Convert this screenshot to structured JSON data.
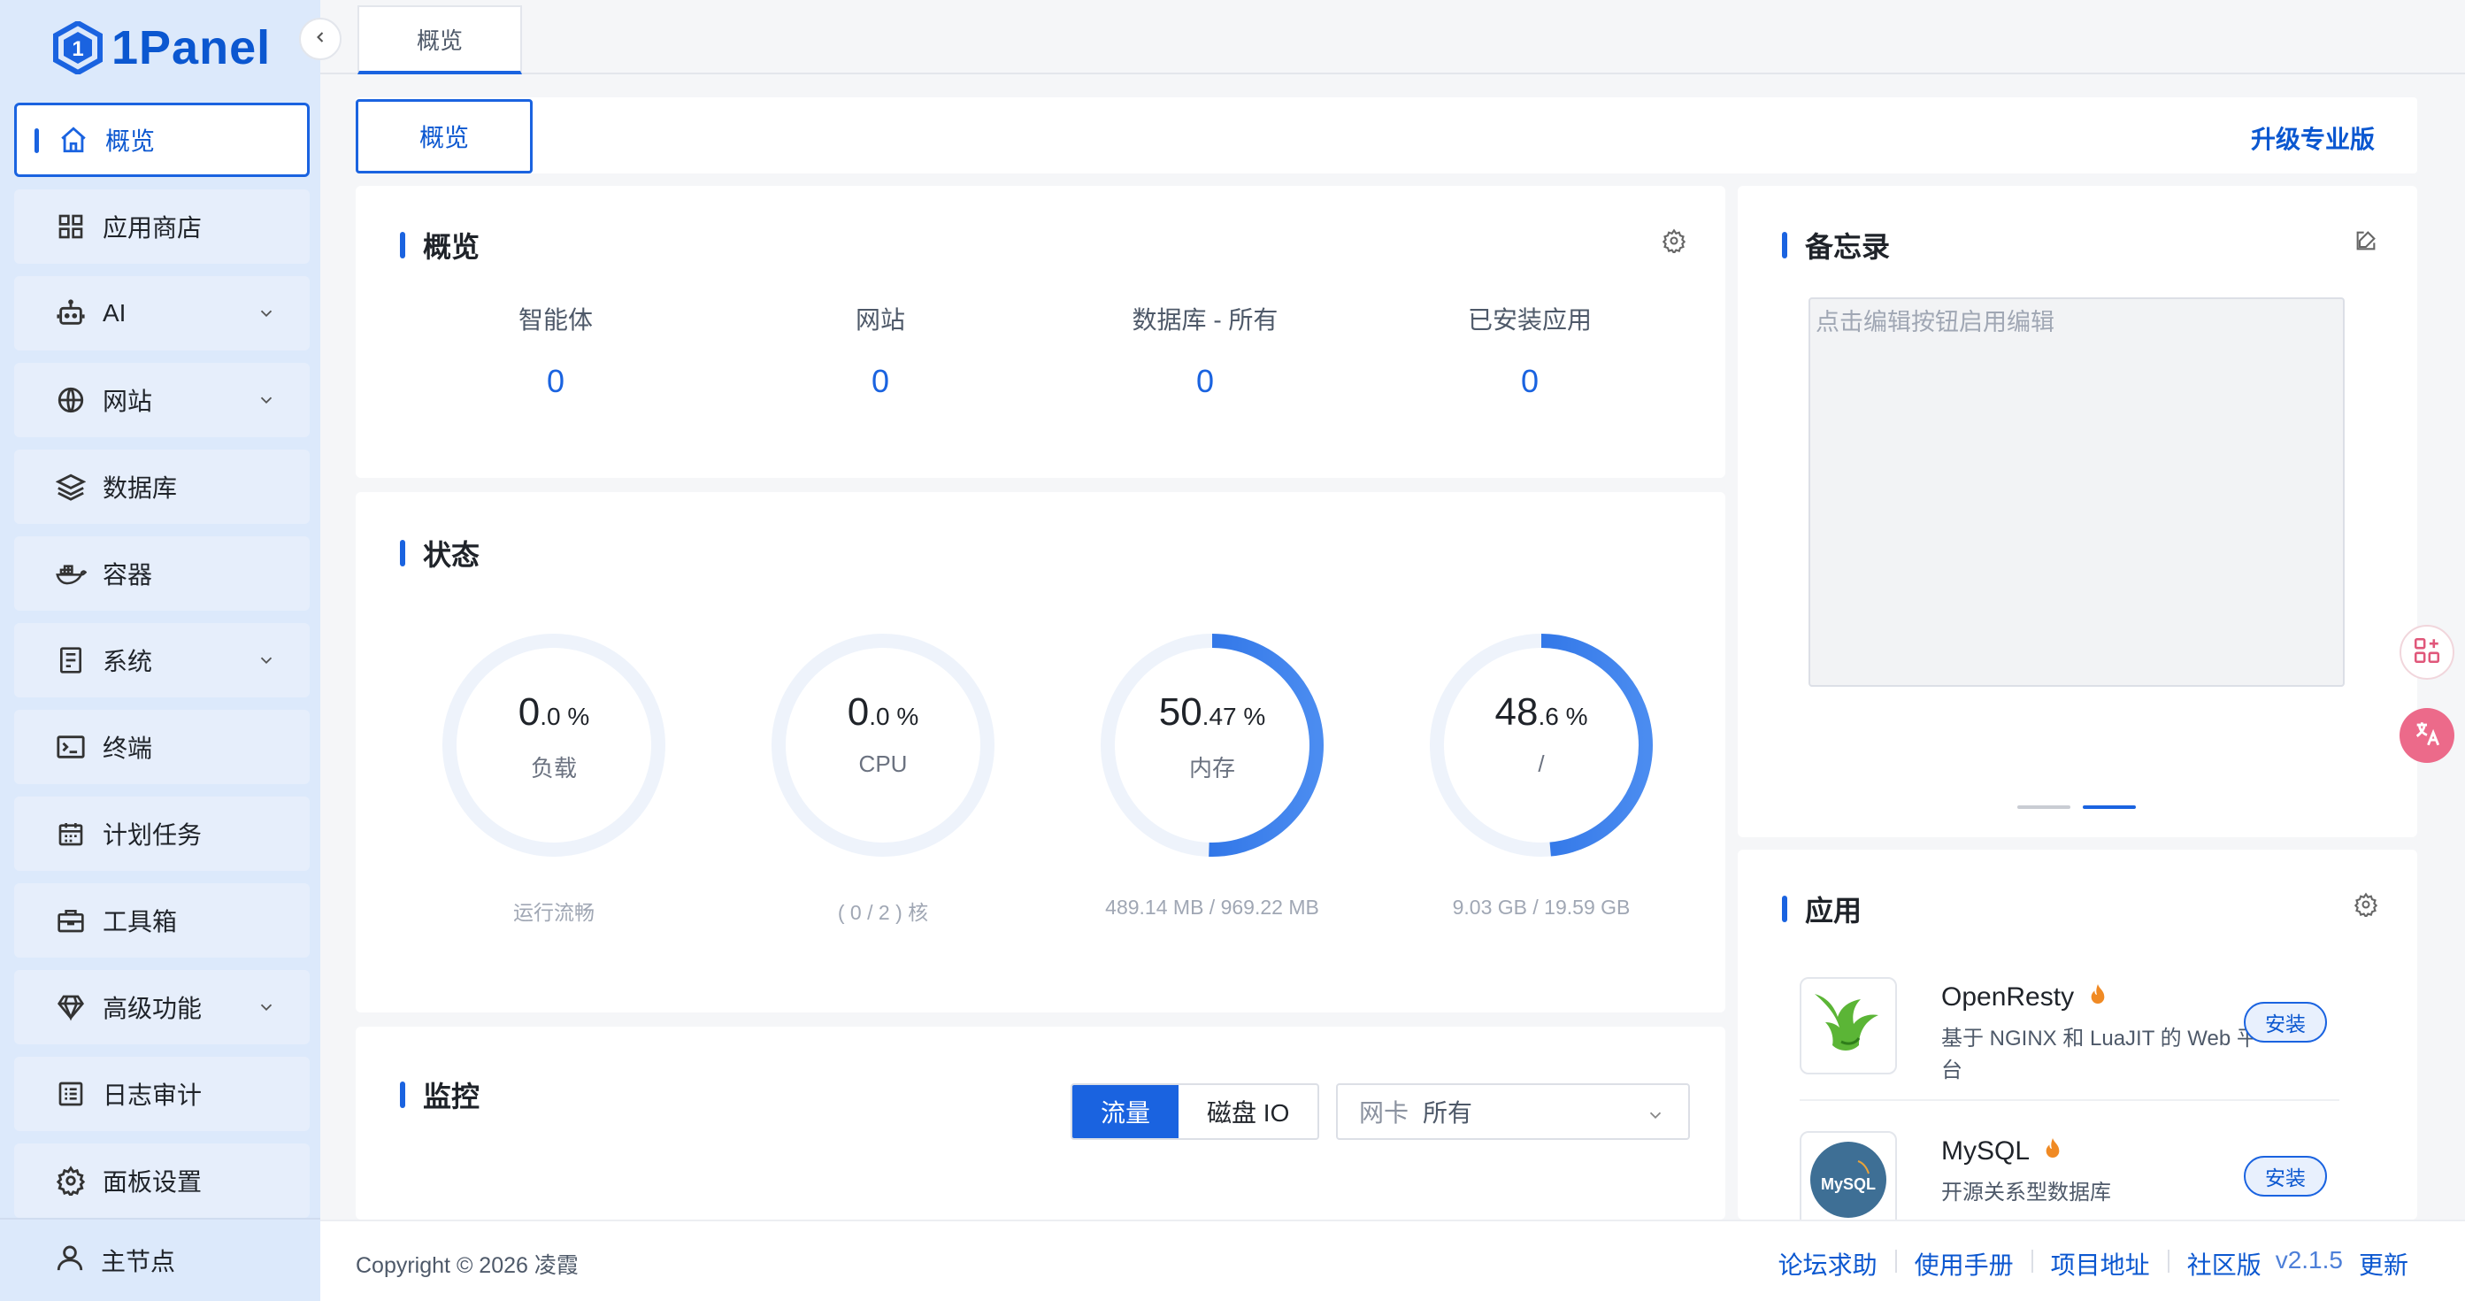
{
  "app": {
    "logo_text": "1Panel"
  },
  "sidebar": {
    "items": [
      {
        "label": "概览",
        "icon": "home-icon",
        "active": true
      },
      {
        "label": "应用商店",
        "icon": "grid-icon"
      },
      {
        "label": "AI",
        "icon": "robot-icon",
        "expandable": true
      },
      {
        "label": "网站",
        "icon": "globe-icon",
        "expandable": true
      },
      {
        "label": "数据库",
        "icon": "layers-icon"
      },
      {
        "label": "容器",
        "icon": "docker-icon"
      },
      {
        "label": "系统",
        "icon": "server-icon",
        "expandable": true
      },
      {
        "label": "终端",
        "icon": "terminal-icon"
      },
      {
        "label": "计划任务",
        "icon": "calendar-icon"
      },
      {
        "label": "工具箱",
        "icon": "toolbox-icon"
      },
      {
        "label": "高级功能",
        "icon": "diamond-icon",
        "expandable": true
      },
      {
        "label": "日志审计",
        "icon": "log-icon"
      },
      {
        "label": "面板设置",
        "icon": "settings-icon"
      }
    ],
    "bottom": {
      "label": "主节点",
      "icon": "user-icon"
    }
  },
  "tabs": [
    {
      "label": "概览"
    }
  ],
  "header": {
    "tab_label": "概览",
    "upgrade_label": "升级专业版"
  },
  "overview": {
    "title": "概览",
    "stats": [
      {
        "label": "智能体",
        "value": "0"
      },
      {
        "label": "网站",
        "value": "0"
      },
      {
        "label": "数据库 - 所有",
        "value": "0"
      },
      {
        "label": "已安装应用",
        "value": "0"
      }
    ]
  },
  "status": {
    "title": "状态",
    "gauges": [
      {
        "int": "0",
        "dec": ".0 %",
        "label": "负载",
        "sub": "运行流畅",
        "percent": 0
      },
      {
        "int": "0",
        "dec": ".0 %",
        "label": "CPU",
        "sub": "( 0 / 2 ) 核",
        "percent": 0
      },
      {
        "int": "50",
        "dec": ".47 %",
        "label": "内存",
        "sub": "489.14 MB / 969.22 MB",
        "percent": 50.47
      },
      {
        "int": "48",
        "dec": ".6 %",
        "label": "/",
        "sub": "9.03 GB / 19.59 GB",
        "percent": 48.6
      }
    ]
  },
  "monitor": {
    "title": "监控",
    "seg_traffic": "流量",
    "seg_disk": "磁盘 IO",
    "select_prefix": "网卡",
    "select_value": "所有"
  },
  "memo": {
    "title": "备忘录",
    "placeholder": "点击编辑按钮启用编辑"
  },
  "apps": {
    "title": "应用",
    "items": [
      {
        "name": "OpenResty",
        "desc": "基于 NGINX 和 LuaJIT 的 Web 平台",
        "button": "安装"
      },
      {
        "name": "MySQL",
        "desc": "开源关系型数据库",
        "button": "安装",
        "logo_text": "MySQL"
      }
    ]
  },
  "footer": {
    "copyright": "Copyright © 2026 凌霞",
    "links": [
      "论坛求助",
      "使用手册",
      "项目地址",
      "社区版"
    ],
    "version": "v2.1.5",
    "update": "更新"
  },
  "colors": {
    "primary": "#1a63e0",
    "sidebar_bg": "#dce9fb",
    "hot": "#f08a24"
  }
}
